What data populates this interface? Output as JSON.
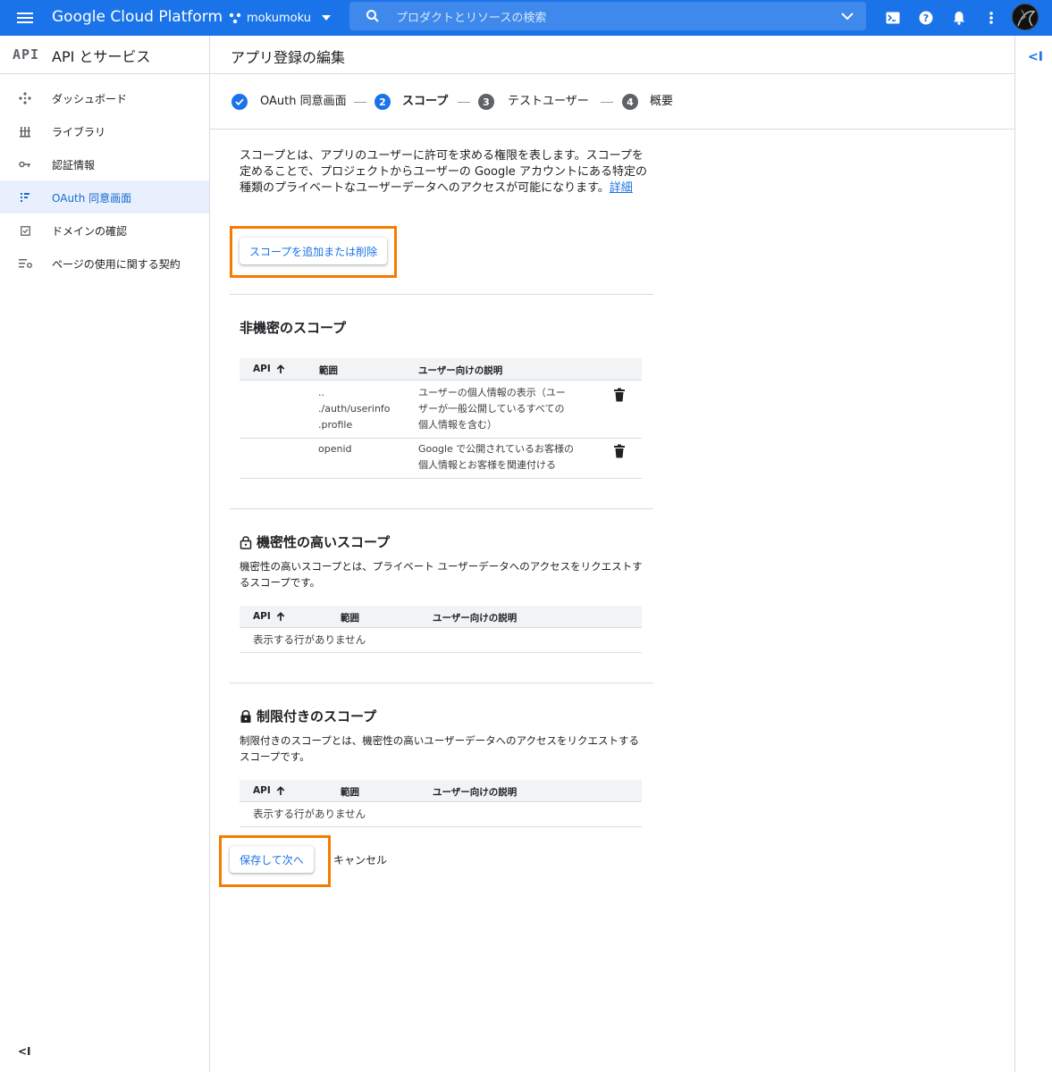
{
  "topbar": {
    "brand": "Google Cloud Platform",
    "project": "mokumoku",
    "search_placeholder": "プロダクトとリソースの検索",
    "color": "#1a73e8"
  },
  "sidebar": {
    "logo": "API",
    "title": "API とサービス",
    "items": [
      {
        "label": "ダッシュボード",
        "icon": "dashboard-icon"
      },
      {
        "label": "ライブラリ",
        "icon": "library-icon"
      },
      {
        "label": "認証情報",
        "icon": "key-icon"
      },
      {
        "label": "OAuth 同意画面",
        "icon": "oauth-consent-icon",
        "active": true
      },
      {
        "label": "ドメインの確認",
        "icon": "domain-verify-icon"
      },
      {
        "label": "ページの使用に関する契約",
        "icon": "page-agreement-icon"
      }
    ],
    "collapse_label": "<I"
  },
  "right_panel": {
    "toggle_label": "<I"
  },
  "page": {
    "title": "アプリ登録の編集"
  },
  "stepper": {
    "steps": [
      {
        "num": "1",
        "label": "OAuth 同意画面",
        "state": "done"
      },
      {
        "num": "2",
        "label": "スコープ",
        "state": "active"
      },
      {
        "num": "3",
        "label": "テストユーザー",
        "state": "pending"
      },
      {
        "num": "4",
        "label": "概要",
        "state": "pending"
      }
    ]
  },
  "intro": {
    "text": "スコープとは、アプリのユーザーに許可を求める権限を表します。スコープを定めることで、プロジェクトからユーザーの Google アカウントにある特定の種類のプライベートなユーザーデータへのアクセスが可能になります。",
    "link": "詳細"
  },
  "add_scope_button": "スコープを追加または削除",
  "columns": {
    "api": "API",
    "scope": "範囲",
    "desc": "ユーザー向けの説明"
  },
  "non_sensitive": {
    "title": "非機密のスコープ",
    "rows": [
      {
        "scope_lines": [
          "..",
          "./auth/userinfo",
          ".profile"
        ],
        "desc_lines": [
          "ユーザーの個人情報の表示（ユー",
          "ザーが一般公開しているすべての",
          "個人情報を含む）"
        ]
      },
      {
        "scope_lines": [
          "openid"
        ],
        "desc_lines": [
          "Google で公開されているお客様の",
          "個人情報とお客様を関連付ける"
        ]
      }
    ]
  },
  "sensitive": {
    "title": "機密性の高いスコープ",
    "desc": "機密性の高いスコープとは、プライベート ユーザーデータへのアクセスをリクエストするスコープです。",
    "empty": "表示する行がありません"
  },
  "restricted": {
    "title": "制限付きのスコープ",
    "desc": "制限付きのスコープとは、機密性の高いユーザーデータへのアクセスをリクエストするスコープです。",
    "empty": "表示する行がありません"
  },
  "actions": {
    "save": "保存して次へ",
    "cancel": "キャンセル"
  },
  "colors": {
    "accent": "#1a73e8",
    "highlight": "#f57c00",
    "step_done": "#1a73e8",
    "step_pending": "#5f6368"
  }
}
